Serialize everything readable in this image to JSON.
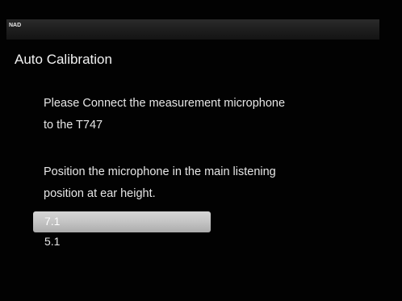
{
  "header": {
    "logo": "NAD"
  },
  "page": {
    "title": "Auto Calibration"
  },
  "instructions": {
    "line1": "Please Connect the measurement microphone",
    "line2": "to the T747",
    "line3": "Position the microphone in the main listening",
    "line4": "position at ear height."
  },
  "options": {
    "items": [
      {
        "label": "7.1",
        "selected": true
      },
      {
        "label": "5.1",
        "selected": false
      }
    ]
  },
  "colors": {
    "background": "#020202",
    "highlight": "#c4c4c4",
    "text": "#e6e6e6"
  }
}
